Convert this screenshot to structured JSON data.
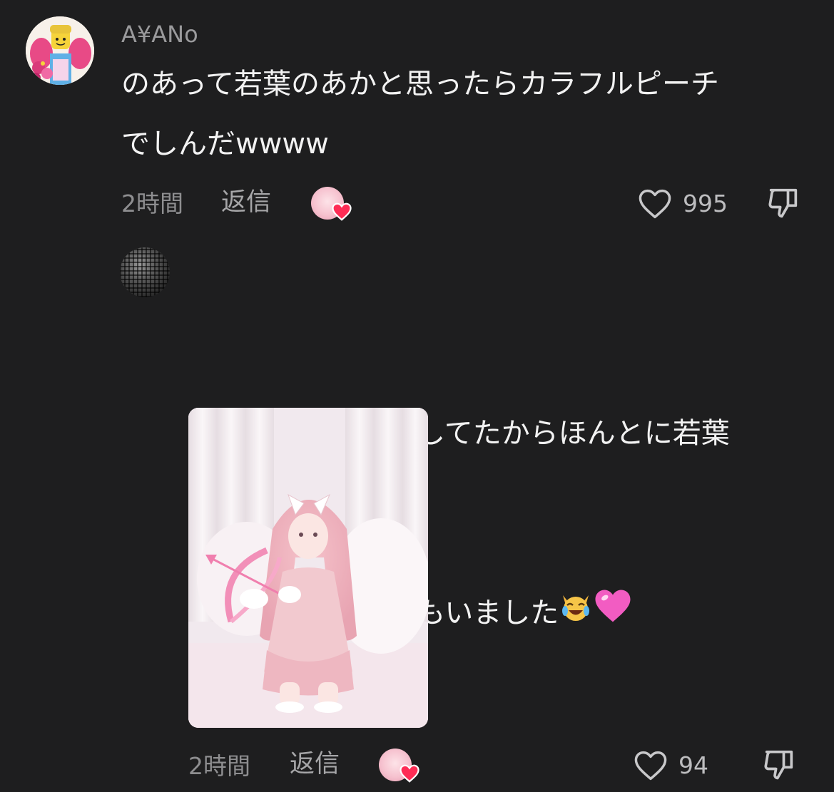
{
  "comment": {
    "username": "A¥ANo",
    "text": "のあって若葉のあかと思ったらカラフルピーチ\nでしんだwwww",
    "time": "2時間",
    "reply_label": "返信",
    "like_count": "995"
  },
  "reply": {
    "text_line1": "今年ピンクコーデしてたからほんとに若葉",
    "text_line2": "のあちゃんかとおもいました",
    "emoji_1": "crying-laughing-cat-emoji",
    "emoji_2": "pink-heart-emoji",
    "time": "2時間",
    "reply_label": "返信",
    "like_count": "94"
  },
  "colors": {
    "background": "#1e1e1f",
    "text": "#f2f2f2",
    "muted": "#8e8e90",
    "creator_heart": "#fe2c55"
  }
}
